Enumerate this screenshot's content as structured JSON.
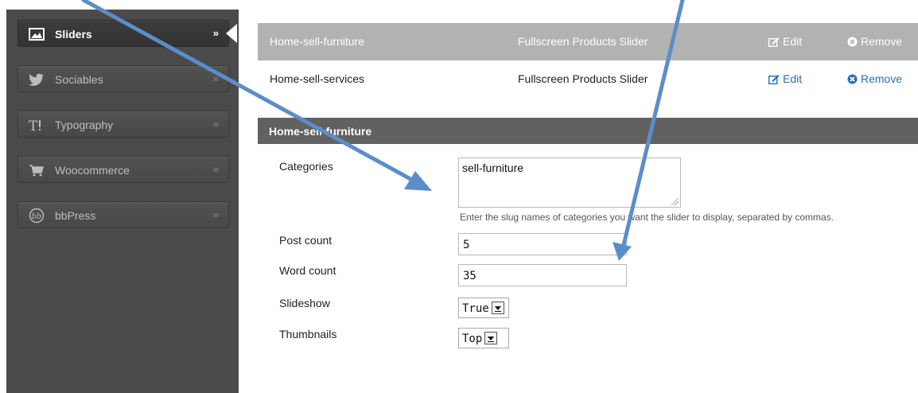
{
  "sidebar": {
    "items": [
      {
        "label": "Sliders",
        "icon": "image-icon",
        "active": true
      },
      {
        "label": "Sociables",
        "icon": "twitter-bird-icon"
      },
      {
        "label": "Typography",
        "icon": "typography-icon"
      },
      {
        "label": "Woocommerce",
        "icon": "cart-icon"
      },
      {
        "label": "bbPress",
        "icon": "bbpress-icon"
      }
    ],
    "chevron": "»"
  },
  "sliders_table": {
    "rows": [
      {
        "name": "Home-sell-furniture",
        "type": "Fullscreen Products Slider",
        "edit": "Edit",
        "remove": "Remove",
        "selected": true
      },
      {
        "name": "Home-sell-services",
        "type": "Fullscreen Products Slider",
        "edit": "Edit",
        "remove": "Remove",
        "selected": false
      }
    ]
  },
  "editor": {
    "title": "Home-sell-furniture",
    "fields": {
      "categories": {
        "label": "Categories",
        "value": "sell-furniture",
        "help": "Enter the slug names of categories you want the slider to display, separated by commas."
      },
      "post_count": {
        "label": "Post count",
        "value": "5"
      },
      "word_count": {
        "label": "Word count",
        "value": "35"
      },
      "slideshow": {
        "label": "Slideshow",
        "value": "True"
      },
      "thumbnails": {
        "label": "Thumbnails",
        "value": "Top"
      }
    }
  },
  "colors": {
    "sidebar_bg": "#4a4a4a",
    "selected_row": "#b2b2b2",
    "section_header": "#616161",
    "link_blue": "#2a6ebb",
    "annotation_arrow": "#5b8dc9"
  }
}
